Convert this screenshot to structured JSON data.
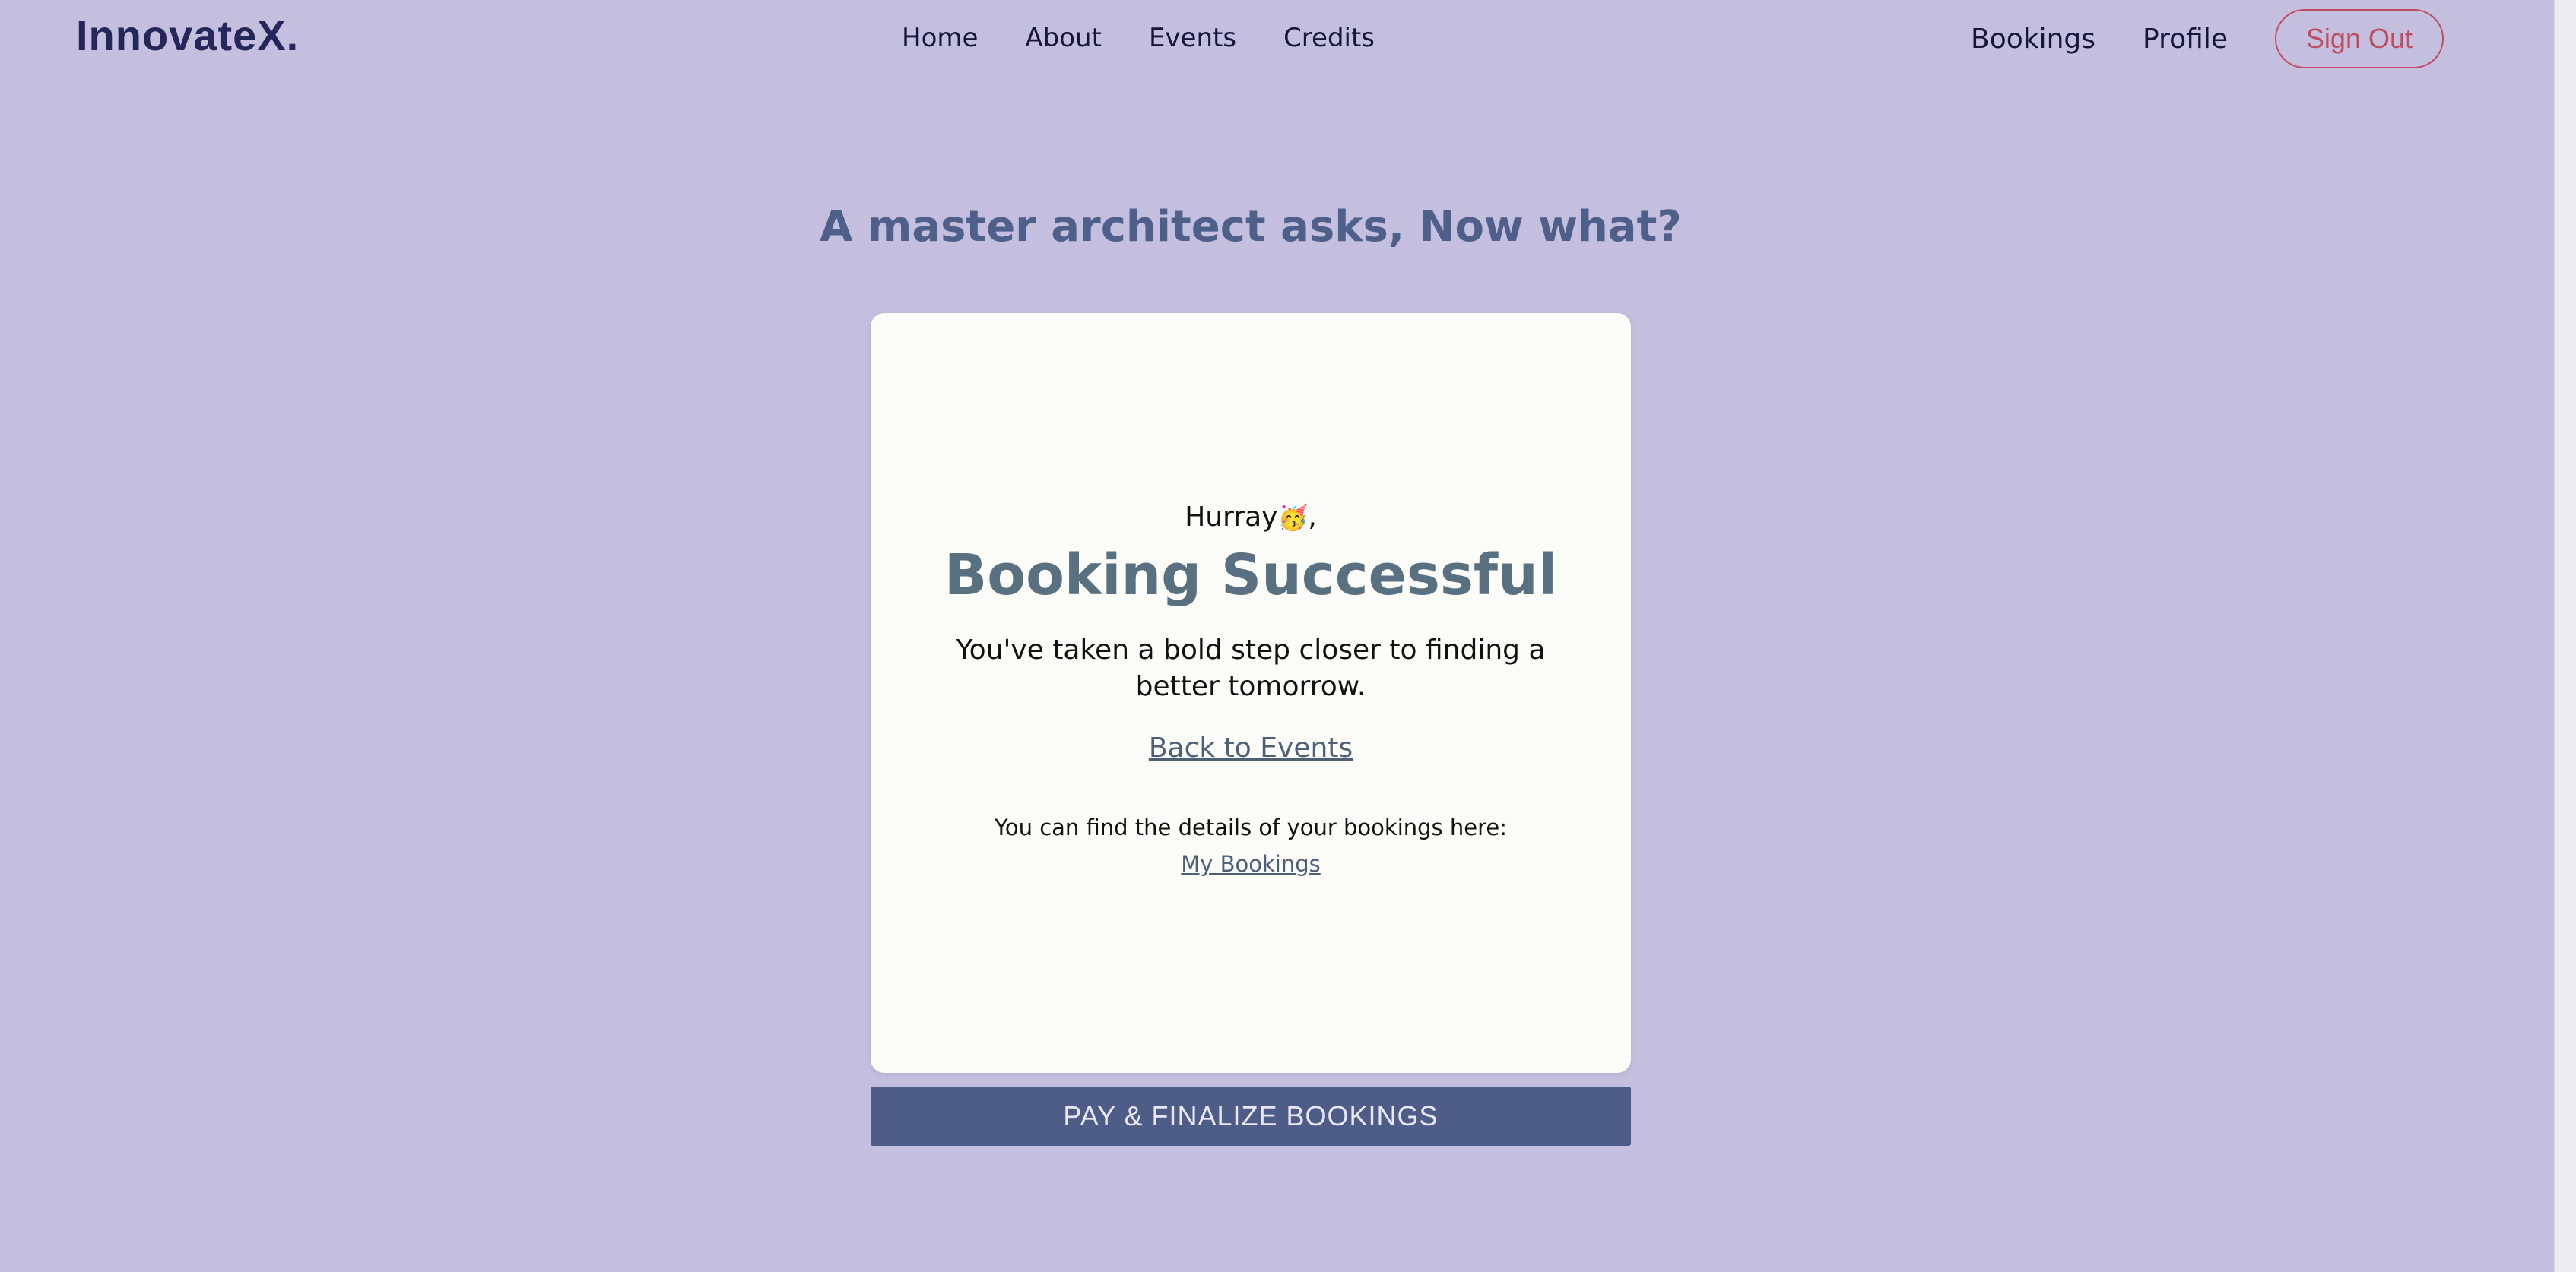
{
  "brand": {
    "logo": "InnovateX."
  },
  "nav": {
    "center": [
      {
        "label": "Home"
      },
      {
        "label": "About"
      },
      {
        "label": "Events"
      },
      {
        "label": "Credits"
      }
    ],
    "right": [
      {
        "label": "Bookings"
      },
      {
        "label": "Profile"
      }
    ],
    "signout_label": "Sign Out"
  },
  "headline": "A master architect asks, Now what?",
  "card": {
    "greeting": "Hurray",
    "greeting_emoji": "🥳",
    "greeting_suffix": ",",
    "title": "Booking Successful",
    "message": "You've taken a bold step closer to finding a better tomorrow.",
    "back_link": "Back to Events",
    "details_note": "You can find the details of your bookings here:",
    "my_bookings_link": "My Bookings"
  },
  "action": {
    "pay_label": "PAY & FINALIZE BOOKINGS"
  },
  "colors": {
    "background": "#c4bfdf",
    "card": "#fbfbf8",
    "accent": "#4e5d87",
    "logo": "#25275a",
    "signout": "#c04b5e"
  }
}
